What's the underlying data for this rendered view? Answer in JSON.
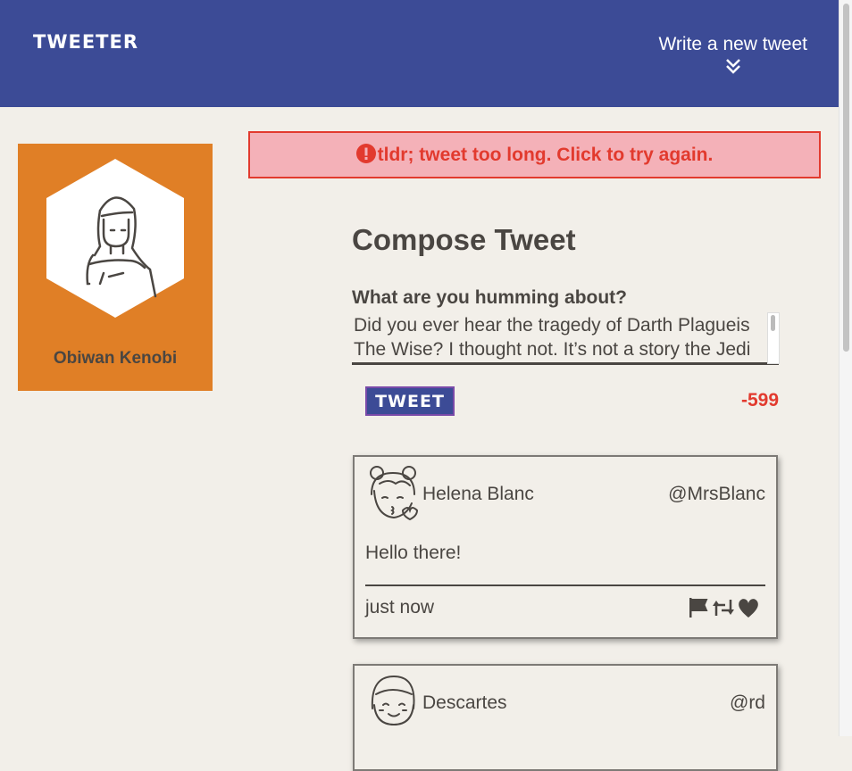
{
  "nav": {
    "brand": "TWEETER",
    "write_new": "Write a new tweet"
  },
  "profile": {
    "name": "Obiwan Kenobi",
    "bg_color": "#e07f26"
  },
  "error": {
    "message": "tldr; tweet too long. Click to try again."
  },
  "compose": {
    "title": "Compose Tweet",
    "label": "What are you humming about?",
    "text": "Did you ever hear the tragedy of Darth Plagueis The Wise? I thought not. It’s not a story the Jedi",
    "button": "TWEET",
    "counter": "-599"
  },
  "tweets": [
    {
      "name": "Helena Blanc",
      "handle": "@MrsBlanc",
      "text": "Hello there!",
      "time": "just now",
      "avatar_icon": "kissing-girl-avatar-icon"
    },
    {
      "name": "Descartes",
      "handle": "@rd",
      "avatar_icon": "smiling-girl-avatar-icon"
    }
  ],
  "colors": {
    "nav": "#3c4b96",
    "background": "#f2efe9",
    "error": "#e23a2e",
    "profile": "#e07f26"
  }
}
